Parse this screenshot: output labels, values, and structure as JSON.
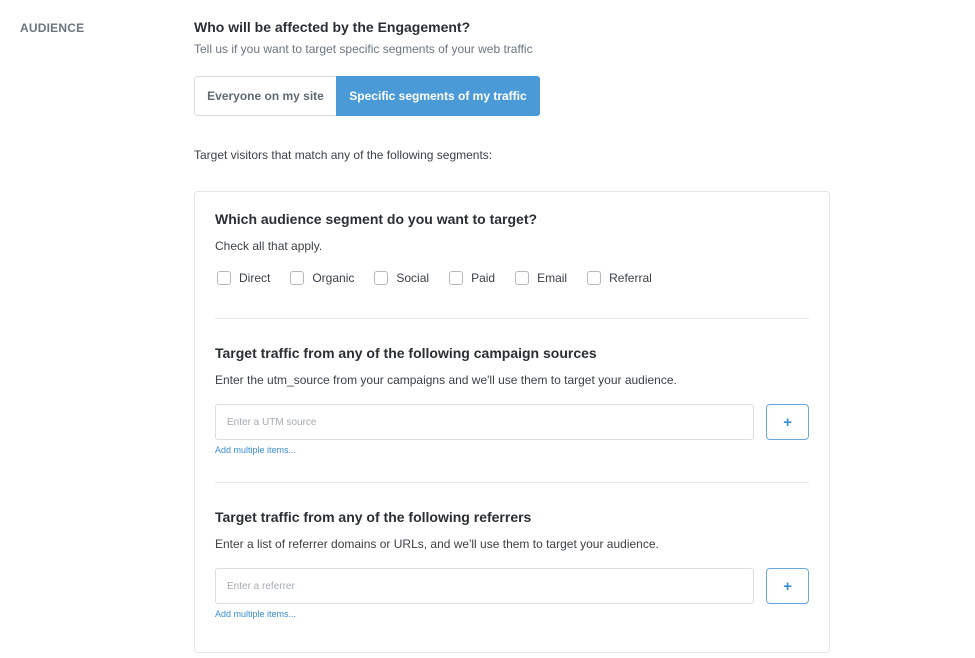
{
  "section_label": "AUDIENCE",
  "header": {
    "title": "Who will be affected by the Engagement?",
    "subtitle": "Tell us if you want to target specific segments of your web traffic"
  },
  "toggle": {
    "options": [
      "Everyone on my site",
      "Specific segments of my traffic"
    ],
    "selected": "Specific segments of my traffic"
  },
  "match_text": "Target visitors that match any of the following segments:",
  "segments": {
    "title": "Which audience segment do you want to target?",
    "subtitle": "Check all that apply.",
    "options": [
      {
        "label": "Direct",
        "checked": false
      },
      {
        "label": "Organic",
        "checked": false
      },
      {
        "label": "Social",
        "checked": false
      },
      {
        "label": "Paid",
        "checked": false
      },
      {
        "label": "Email",
        "checked": false
      },
      {
        "label": "Referral",
        "checked": false
      }
    ]
  },
  "campaign_sources": {
    "title": "Target traffic from any of the following campaign sources",
    "subtitle": "Enter the utm_source from your campaigns and we'll use them to target your audience.",
    "placeholder": "Enter a UTM source",
    "value": "",
    "add_button": "+",
    "add_multiple": "Add multiple items..."
  },
  "referrers": {
    "title": "Target traffic from any of the following referrers",
    "subtitle": "Enter a list of referrer domains or URLs, and we'll use them to target your audience.",
    "placeholder": "Enter a referrer",
    "value": "",
    "add_button": "+",
    "add_multiple": "Add multiple items..."
  },
  "colors": {
    "accent": "#4a9ad8",
    "link": "#3a8fd4"
  }
}
